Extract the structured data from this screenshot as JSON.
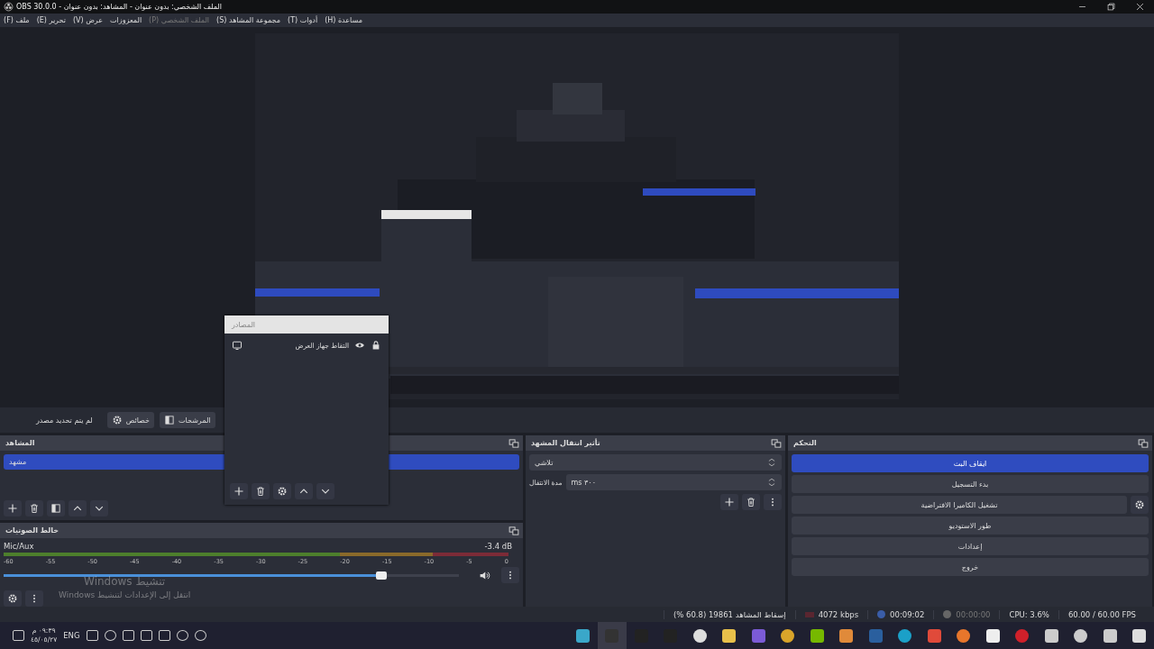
{
  "window": {
    "title": "الملف الشخصي: بدون عنوان - المشاهد: بدون عنوان - OBS 30.0.0"
  },
  "menu": [
    {
      "label": "مساعدة (H)",
      "disabled": false
    },
    {
      "label": "أدوات (T)",
      "disabled": false
    },
    {
      "label": "مجموعة المشاهد (S)",
      "disabled": false
    },
    {
      "label": "الملف الشخصي (P)",
      "disabled": true
    },
    {
      "label": "المعزوزات",
      "disabled": false
    },
    {
      "label": "عرض (V)",
      "disabled": false
    },
    {
      "label": "تحرير (E)",
      "disabled": false
    },
    {
      "label": "ملف (F)",
      "disabled": false
    }
  ],
  "source_toolbar": {
    "status": "لم يتم تحديد مصدر",
    "buttons": [
      {
        "label": "المرشحات",
        "kind": "filter"
      },
      {
        "label": "خصائص",
        "kind": "gear"
      }
    ]
  },
  "scenes": {
    "title": "المشاهد",
    "items": [
      {
        "name": "مشهد",
        "selected": true
      }
    ]
  },
  "sources": {
    "title": "المصادر",
    "items": [
      {
        "name": "التقاط جهاز العرض",
        "visible": true,
        "locked": true
      }
    ]
  },
  "audio_mixer": {
    "title": "خالط الصوتيات",
    "scale": [
      "0",
      "-5",
      "-10",
      "-15",
      "-20",
      "-25",
      "-30",
      "-35",
      "-40",
      "-45",
      "-50",
      "-55",
      "-60"
    ],
    "channels": [
      {
        "name": "Mic/Aux",
        "reading": "-3.4 dB",
        "level": 0.83,
        "muted": false
      }
    ]
  },
  "transitions": {
    "title": "تأثير انتقال المشهد",
    "effect": "تلاشي",
    "duration_label": "مدة الانتقال",
    "duration": "٣٠٠ ms"
  },
  "controls": {
    "title": "التحكم",
    "buttons": [
      {
        "label": "ايقاف البث",
        "active": true,
        "settings": false
      },
      {
        "label": "بدء التسجيل",
        "active": false,
        "settings": false
      },
      {
        "label": "تشغيل الكاميرا الافتراضية",
        "active": false,
        "settings": true
      },
      {
        "label": "طور الاستوديو",
        "active": false,
        "settings": false
      },
      {
        "label": "إعدادات",
        "active": false,
        "settings": false
      },
      {
        "label": "خروج",
        "active": false,
        "settings": false
      }
    ]
  },
  "status_bar": {
    "dropped": "إسقاط المشاهد 19861 (60.8 %)",
    "bitrate": "4072 kbps",
    "stream_time": "00:09:02",
    "record_time": "00:00:00",
    "cpu": "CPU: 3.6%",
    "fps": "60.00 / 60.00 FPS"
  },
  "activation_notice": {
    "title": "تنشيط Windows",
    "hint": "انتقل إلى الإعدادات لتنشيط Windows"
  },
  "taskbar": {
    "clock_time": "٠٩:٣٩ م",
    "clock_date": "٤٥/٠٥/٢٧",
    "language": "ENG"
  }
}
